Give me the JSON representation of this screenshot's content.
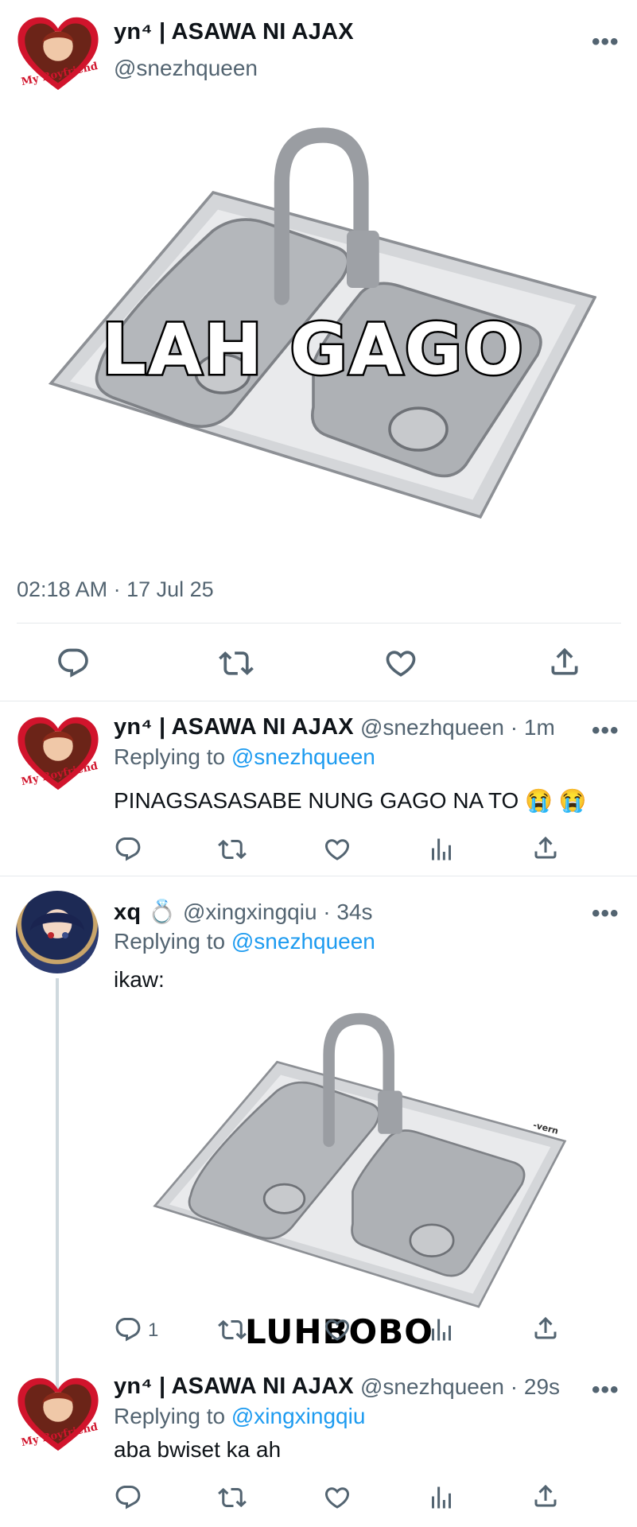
{
  "main_tweet": {
    "display_name": "yn⁴ | ASAWA NI AJAX",
    "handle": "@snezhqueen",
    "image_caption": "LAH GAGO",
    "timestamp": "02:18 AM · 17 Jul 25",
    "avatar_text": "My Boyfriend"
  },
  "replies": [
    {
      "display_name": "yn⁴ | ASAWA NI AJAX",
      "handle_time": "@snezhqueen · 1m",
      "replying_label": "Replying to",
      "replying_to": "@snezhqueen",
      "text": "PINAGSASASABE NUNG GAGO NA TO 😭 😭",
      "avatar_text": "My Boyfriend"
    },
    {
      "display_name": "xq 💍",
      "handle_time": "@xingxingqiu · 34s",
      "replying_label": "Replying to",
      "replying_to": "@snezhqueen",
      "text": "ikaw:",
      "image_caption": "LUHBOBO",
      "image_watermark": "-vern",
      "reply_count": "1"
    },
    {
      "display_name": "yn⁴ | ASAWA NI AJAX",
      "handle_time": "@snezhqueen · 29s",
      "replying_label": "Replying to",
      "replying_to": "@xingxingqiu",
      "text": "aba bwiset ka ah",
      "avatar_text": "My Boyfriend"
    }
  ],
  "more_label": "•••",
  "colors": {
    "link": "#1d9bf0",
    "secondary": "#536471",
    "text": "#0f1419",
    "divider": "#e6e9ec"
  }
}
